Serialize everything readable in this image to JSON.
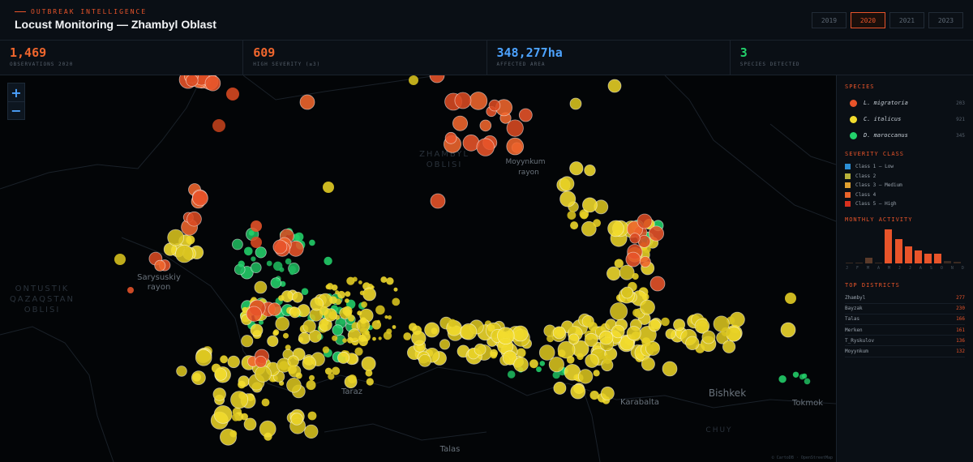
{
  "header": {
    "eyebrow": "OUTBREAK INTELLIGENCE",
    "title": "Locust Monitoring — Zhambyl Oblast",
    "years": [
      {
        "label": "2019",
        "active": false
      },
      {
        "label": "2020",
        "active": true
      },
      {
        "label": "2021",
        "active": false
      },
      {
        "label": "2023",
        "active": false
      }
    ]
  },
  "stats": [
    {
      "value": "1,469",
      "label": "OBSERVATIONS 2020",
      "color": "#f0662d"
    },
    {
      "value": "609",
      "label": "HIGH SEVERITY (≥3)",
      "color": "#f0662d"
    },
    {
      "value": "348,277ha",
      "label": "AFFECTED AREA",
      "color": "#4da3ff"
    },
    {
      "value": "3",
      "label": "SPECIES DETECTED",
      "color": "#23d16b"
    }
  ],
  "map": {
    "zoom_in": "+",
    "zoom_out": "−",
    "labels": [
      {
        "text": "ZHAMBYL",
        "cls": "region"
      },
      {
        "text": "OBLISI",
        "cls": "region"
      },
      {
        "text": "Moyynkum",
        "cls": "city"
      },
      {
        "text": "rayon",
        "cls": "city"
      },
      {
        "text": "ONTUSTIK",
        "cls": "region"
      },
      {
        "text": "QAZAQSTAN",
        "cls": "region"
      },
      {
        "text": "OBLISI",
        "cls": "region"
      },
      {
        "text": "Sarysuskiy",
        "cls": "city"
      },
      {
        "text": "rayon",
        "cls": "city"
      },
      {
        "text": "Taraz",
        "cls": "city"
      },
      {
        "text": "Karabalta",
        "cls": "city"
      },
      {
        "text": "Bishkek",
        "cls": "city"
      },
      {
        "text": "Tokmok",
        "cls": "city"
      },
      {
        "text": "Talas",
        "cls": "city"
      },
      {
        "text": "CHUY",
        "cls": "region"
      }
    ],
    "attribution": "© CartoDB · OpenStreetMap"
  },
  "sidebar": {
    "species_title": "SPECIES",
    "species": [
      {
        "name": "L. migratoria",
        "count": "203",
        "color": "#e8542a"
      },
      {
        "name": "C. italicus",
        "count": "921",
        "color": "#f2dc2e"
      },
      {
        "name": "D. maroccanus",
        "count": "345",
        "color": "#23d16b"
      }
    ],
    "severity_title": "SEVERITY CLASS",
    "severity": [
      {
        "label": "Class 1 — Low",
        "color": "#2b8fd6"
      },
      {
        "label": "Class 2",
        "color": "#b8b23a"
      },
      {
        "label": "Class 3 — Medium",
        "color": "#e0a030"
      },
      {
        "label": "Class 4",
        "color": "#e8642a"
      },
      {
        "label": "Class 5 — High",
        "color": "#d8301e"
      }
    ],
    "monthly_title": "MONTHLY ACTIVITY",
    "months": [
      "J",
      "F",
      "M",
      "A",
      "M",
      "J",
      "J",
      "A",
      "S",
      "O",
      "N",
      "D"
    ],
    "monthly_values": [
      0.02,
      0.02,
      0.15,
      0.02,
      1.0,
      0.7,
      0.48,
      0.38,
      0.28,
      0.28,
      0.05,
      0.03
    ],
    "districts_title": "TOP DISTRICTS",
    "districts": [
      {
        "name": "Zhambyl",
        "value": "277"
      },
      {
        "name": "Bayzak",
        "value": "230"
      },
      {
        "name": "Talas",
        "value": "166"
      },
      {
        "name": "Merken",
        "value": "161"
      },
      {
        "name": "T_Ryskulov",
        "value": "136"
      },
      {
        "name": "Moyynkum",
        "value": "132"
      }
    ]
  }
}
